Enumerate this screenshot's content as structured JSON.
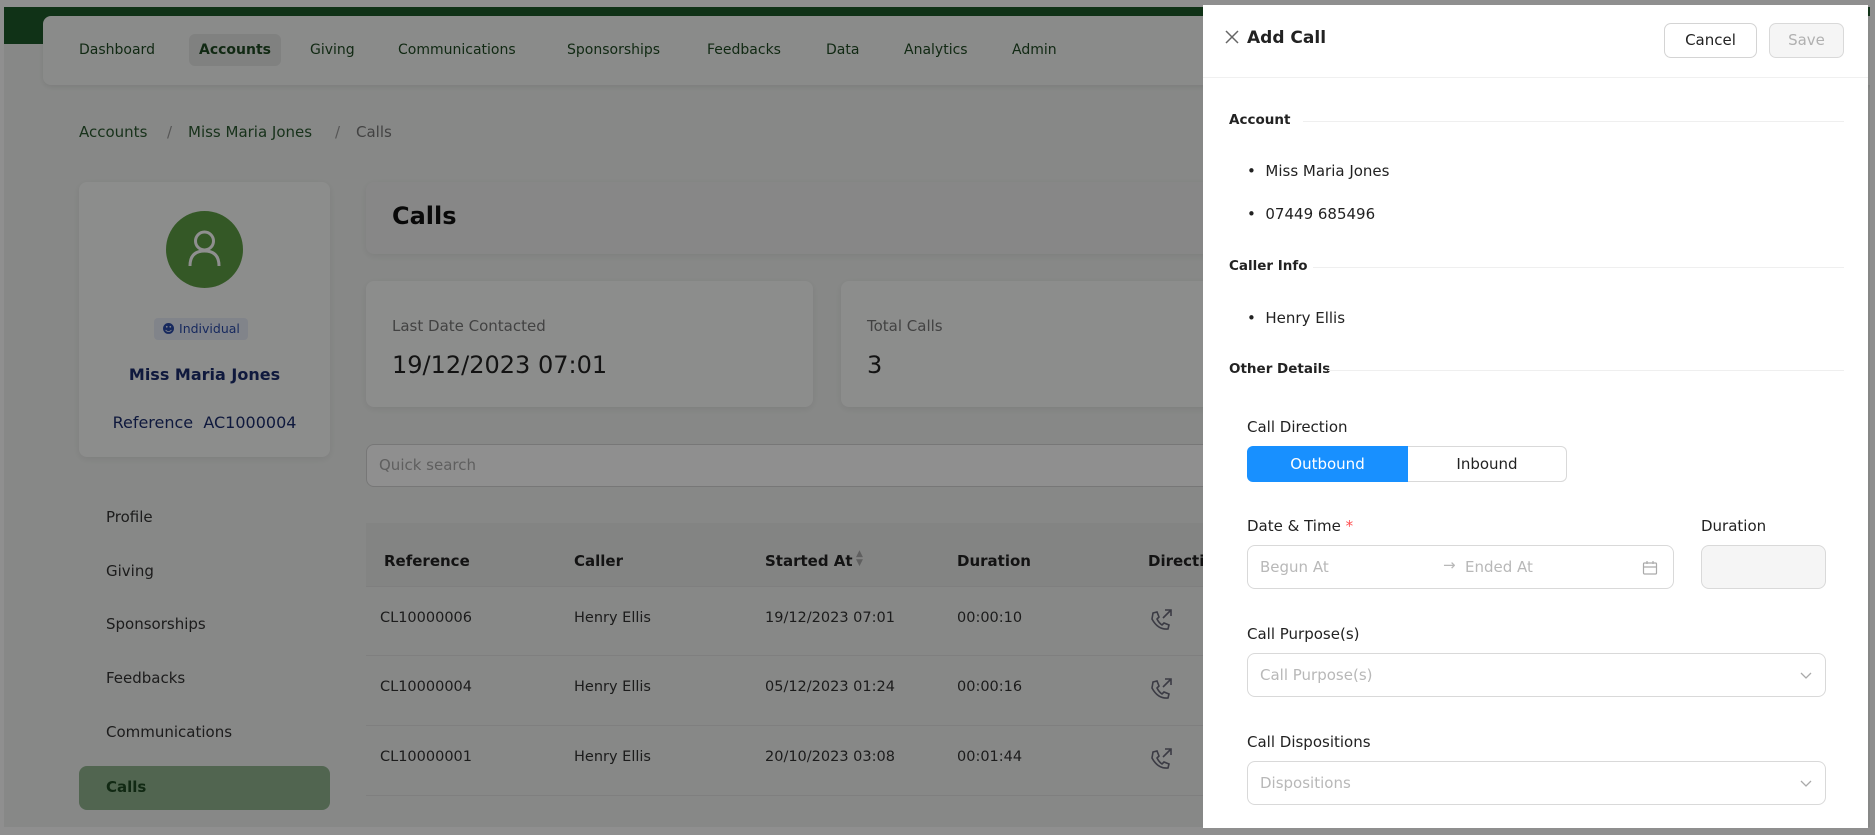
{
  "nav": {
    "items": [
      "Dashboard",
      "Accounts",
      "Giving",
      "Communications",
      "Sponsorships",
      "Feedbacks",
      "Data",
      "Analytics",
      "Admin"
    ],
    "active": "Accounts"
  },
  "breadcrumb": [
    "Accounts",
    "Miss Maria Jones",
    "Calls"
  ],
  "profile": {
    "badge": "Individual",
    "name": "Miss Maria Jones",
    "reference_label": "Reference",
    "reference": "AC1000004"
  },
  "sidebar": {
    "items": [
      "Profile",
      "Giving",
      "Sponsorships",
      "Feedbacks",
      "Communications",
      "Calls"
    ],
    "active": "Calls"
  },
  "main": {
    "title": "Calls",
    "stats": [
      {
        "label": "Last Date Contacted",
        "value": "19/12/2023 07:01"
      },
      {
        "label": "Total Calls",
        "value": "3"
      }
    ],
    "search_placeholder": "Quick search",
    "table": {
      "columns": [
        "Reference",
        "Caller",
        "Started At",
        "Duration",
        "Direction"
      ],
      "rows": [
        {
          "reference": "CL10000006",
          "caller": "Henry Ellis",
          "started_at": "19/12/2023 07:01",
          "duration": "00:00:10",
          "direction": "outbound-call-icon"
        },
        {
          "reference": "CL10000004",
          "caller": "Henry Ellis",
          "started_at": "05/12/2023 01:24",
          "duration": "00:00:16",
          "direction": "outbound-call-icon"
        },
        {
          "reference": "CL10000001",
          "caller": "Henry Ellis",
          "started_at": "20/10/2023 03:08",
          "duration": "00:01:44",
          "direction": "outbound-call-icon"
        }
      ]
    }
  },
  "panel": {
    "title": "Add Call",
    "cancel": "Cancel",
    "save": "Save",
    "account_heading": "Account",
    "account_items": [
      "Miss Maria Jones",
      "07449 685496"
    ],
    "caller_heading": "Caller Info",
    "caller_items": [
      "Henry Ellis"
    ],
    "other_heading": "Other Details",
    "direction_label": "Call Direction",
    "direction_options": [
      "Outbound",
      "Inbound"
    ],
    "direction_selected": "Outbound",
    "datetime_label": "Date & Time",
    "required_mark": "*",
    "begun_placeholder": "Begun At",
    "ended_placeholder": "Ended At",
    "duration_label": "Duration",
    "purpose_label": "Call Purpose(s)",
    "purpose_placeholder": "Call Purpose(s)",
    "dispositions_label": "Call Dispositions",
    "dispositions_placeholder": "Dispositions"
  },
  "colors": {
    "brand_green": "#1e5a2a",
    "accent_blue": "#1890ff",
    "required_red": "#ff4d4f"
  }
}
